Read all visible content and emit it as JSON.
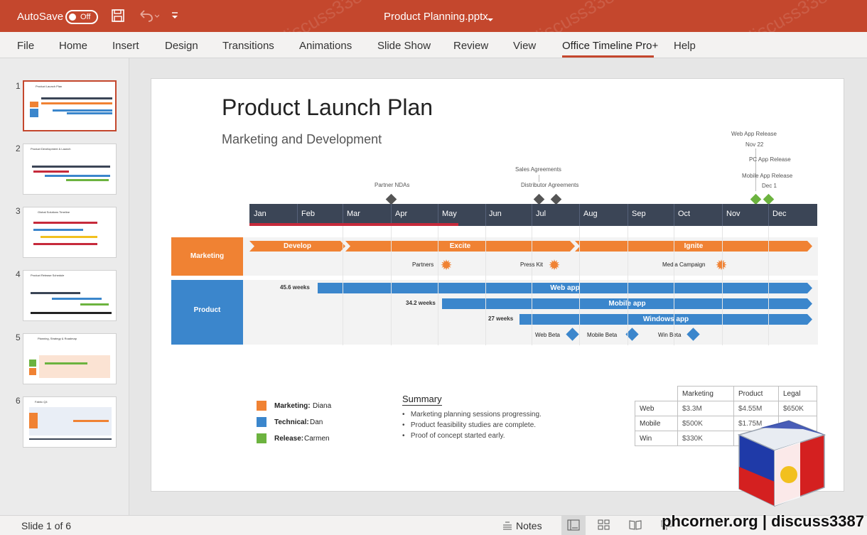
{
  "titlebar": {
    "autosave_label": "AutoSave",
    "toggle_state": "Off",
    "doc_title": "Product Planning.pptx",
    "icons": [
      "save-icon",
      "undo-icon",
      "customize-icon"
    ]
  },
  "ribbon": {
    "tabs": [
      "File",
      "Home",
      "Insert",
      "Design",
      "Transitions",
      "Animations",
      "Slide Show",
      "Review",
      "View",
      "Office Timeline Pro+",
      "Help"
    ],
    "active": "Office Timeline Pro+"
  },
  "thumbnails": [
    {
      "num": "1",
      "title": "Product Launch Plan"
    },
    {
      "num": "2",
      "title": "Product Development & Launch"
    },
    {
      "num": "3",
      "title": "Global Solutions Timeline"
    },
    {
      "num": "4",
      "title": "Product Release Schedule"
    },
    {
      "num": "5",
      "title": "Planning, Strategy & Roadmap"
    },
    {
      "num": "6",
      "title": "Fabric Q4"
    }
  ],
  "slide": {
    "title": "Product Launch Plan",
    "subtitle": "Marketing and Development",
    "months": [
      "Jan",
      "Feb",
      "Mar",
      "Apr",
      "May",
      "Jun",
      "Jul",
      "Aug",
      "Sep",
      "Oct",
      "Nov",
      "Dec"
    ],
    "milestones_above": {
      "partner_ndas": "Partner NDAs",
      "sales_agreements": "Sales Agreements",
      "distributor_agreements": "Distributor Agreements",
      "web_app_release": "Web App Release",
      "web_app_date": "Nov 22",
      "pc_app_release": "PC App Release",
      "mobile_app_release": "Mobile App Release",
      "mobile_app_date": "Dec 1"
    },
    "marketing": {
      "label": "Marketing",
      "tasks": [
        "Develop",
        "Excite",
        "Ignite"
      ],
      "milestones": [
        "Partners",
        "Press Kit",
        "Media Campaign"
      ]
    },
    "product": {
      "label": "Product",
      "tasks": [
        {
          "name": "Web app",
          "duration": "45.6 weeks"
        },
        {
          "name": "Mobile app",
          "duration": "34.2 weeks"
        },
        {
          "name": "Windows app",
          "duration": "27 weeks"
        }
      ],
      "milestones": [
        "Web Beta",
        "Mobile Beta",
        "Win Beta"
      ]
    },
    "legend": [
      {
        "key": "Marketing:",
        "value": "Diana",
        "color": "#f08233"
      },
      {
        "key": "Technical:",
        "value": "Dan",
        "color": "#3b86cc"
      },
      {
        "key": "Release:",
        "value": "Carmen",
        "color": "#6cb33f"
      }
    ],
    "summary": {
      "title": "Summary",
      "items": [
        "Marketing planning sessions progressing.",
        "Product feasibility studies are complete.",
        "Proof of concept started early."
      ]
    },
    "table": {
      "headers": [
        "Marketing",
        "Product",
        "Legal"
      ],
      "rows": [
        {
          "label": "Web",
          "values": [
            "$3.3M",
            "$4.55M",
            "$650K"
          ]
        },
        {
          "label": "Mobile",
          "values": [
            "$500K",
            "$1.75M",
            ""
          ]
        },
        {
          "label": "Win",
          "values": [
            "$330K",
            "",
            ""
          ]
        }
      ]
    }
  },
  "status": {
    "slide_count": "Slide 1 of 6",
    "notes_label": "Notes"
  },
  "watermark": {
    "text": "discuss3387",
    "footer": "phcorner.org | discuss3387"
  },
  "colors": {
    "brand": "#c4472d",
    "marketing": "#f08233",
    "product": "#3b86cc",
    "release": "#6cb33f",
    "axis": "#3b4556"
  }
}
